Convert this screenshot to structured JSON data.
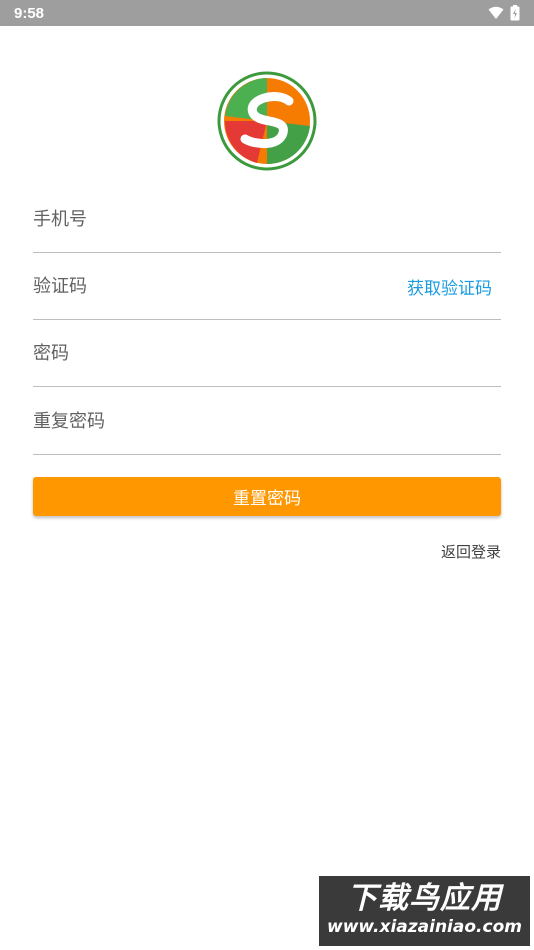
{
  "status_bar": {
    "time": "9:58",
    "icons": [
      "wifi-icon",
      "battery-icon"
    ]
  },
  "logo": {
    "icon": "app-logo-icon",
    "colors": [
      "#e53935",
      "#f57c00",
      "#43a047",
      "#ffffff"
    ]
  },
  "form": {
    "phone_placeholder": "手机号",
    "code_placeholder": "验证码",
    "get_code_label": "获取验证码",
    "password_placeholder": "密码",
    "confirm_password_placeholder": "重复密码"
  },
  "actions": {
    "reset_label": "重置密码",
    "back_label": "返回登录"
  },
  "watermark": {
    "title": "下载鸟应用",
    "url": "www.xiazainiao.com"
  },
  "colors": {
    "accent": "#ff9800",
    "link": "#1a9be0",
    "status_bar": "#9e9e9e"
  }
}
